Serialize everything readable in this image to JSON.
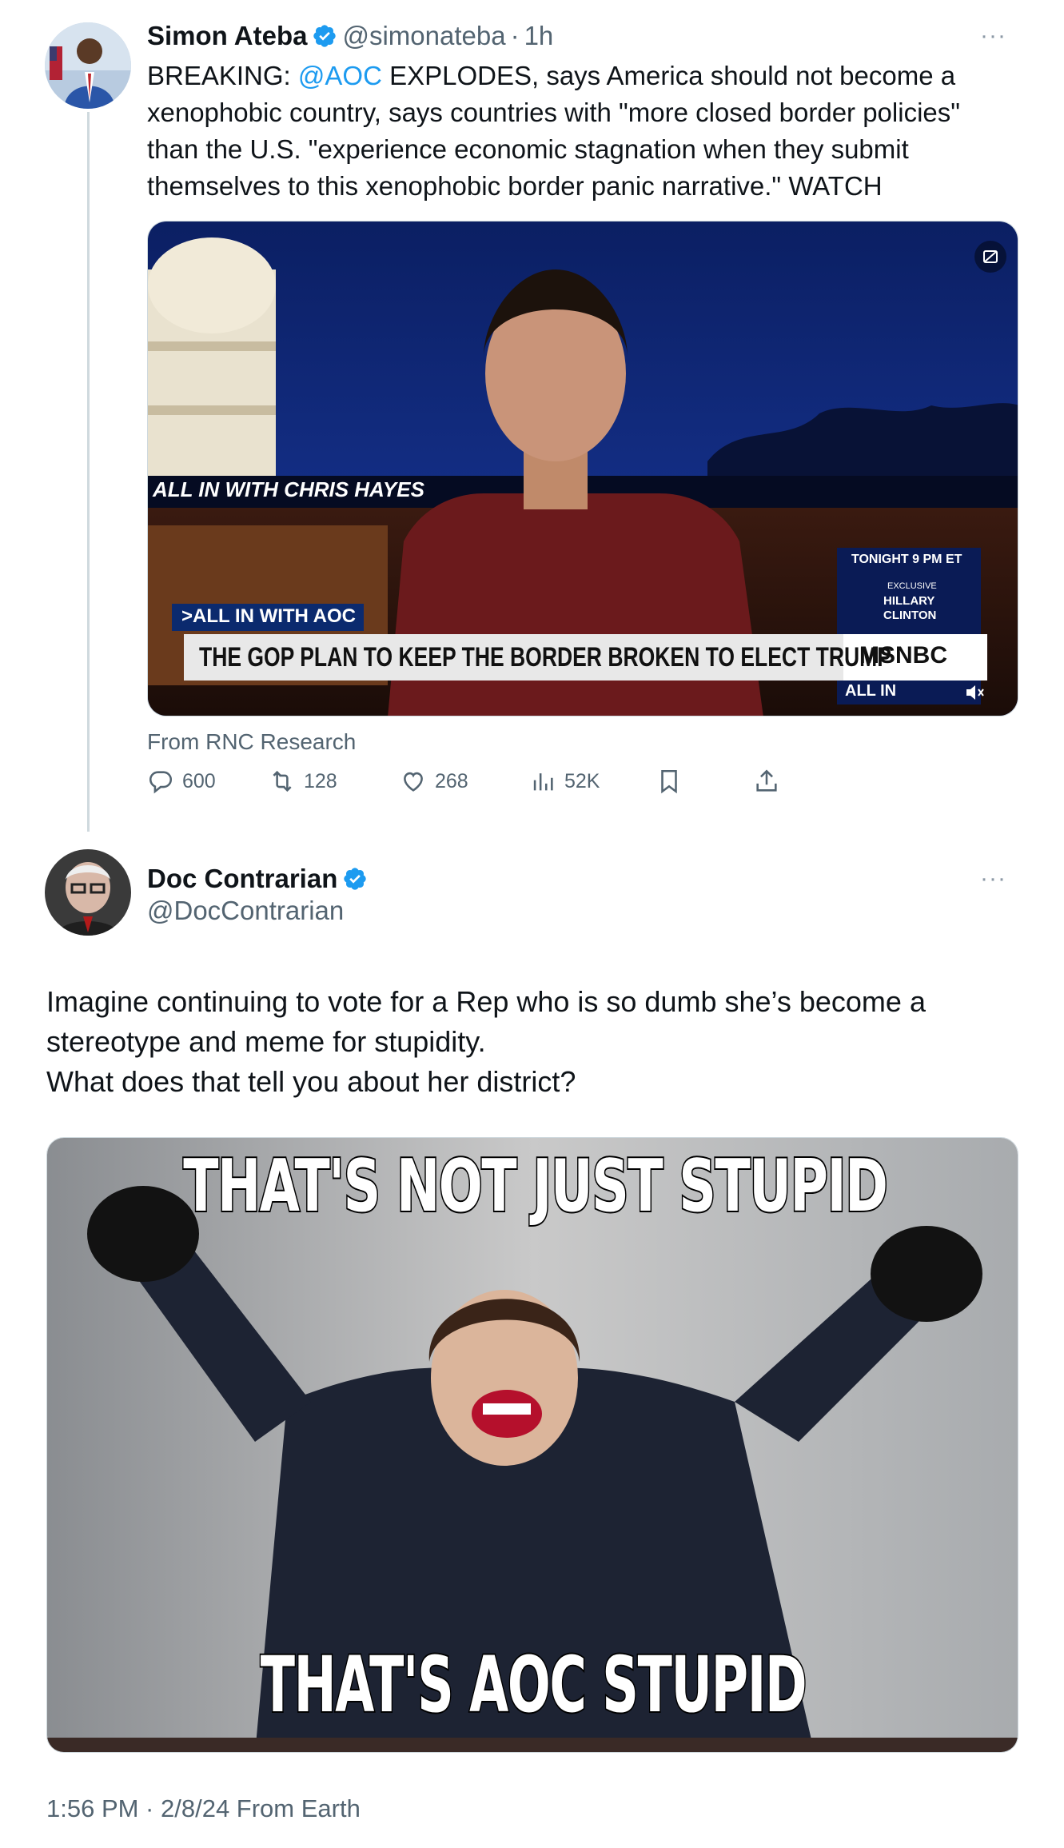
{
  "tweet1": {
    "name": "Simon Ateba",
    "handle": "@simonateba",
    "separator": "·",
    "time": "1h",
    "more": "···",
    "text_prefix": "BREAKING: ",
    "mention": "@AOC",
    "text_suffix": " EXPLODES, says America should not become a xenophobic country, says countries with \"more closed border policies\" than the U.S. \"experience economic stagnation when they submit themselves to this xenophobic border panic narrative.\" WATCH",
    "video": {
      "chyron_top": ">ALL IN WITH AOC",
      "chyron_main": "THE GOP PLAN TO KEEP THE BORDER BROKEN TO ELECT TRUMP",
      "promo_time": "TONIGHT 9 PM ET",
      "promo_exclusive": "EXCLUSIVE",
      "promo_name": "HILLARY CLINTON",
      "network": "MSNBC",
      "show": "ALL IN",
      "ticker": "ALL IN WITH CHRIS HAYES"
    },
    "from": "From RNC Research",
    "stats": {
      "replies": "600",
      "retweets": "128",
      "likes": "268",
      "views": "52K"
    }
  },
  "tweet2": {
    "name": "Doc Contrarian",
    "handle": "@DocContrarian",
    "more": "···",
    "text_line1": "Imagine continuing to vote for a Rep who is so dumb she’s become a stereotype and meme for stupidity.",
    "text_line2": "What does that tell you about her district?",
    "meme_top": "THAT'S NOT JUST STUPID",
    "meme_bottom": "THAT'S AOC STUPID",
    "timestamp": "1:56 PM · 2/8/24 From Earth"
  },
  "colors": {
    "link": "#1d9bf0",
    "secondary_text": "#536471",
    "verified": "#1d9bf0"
  }
}
